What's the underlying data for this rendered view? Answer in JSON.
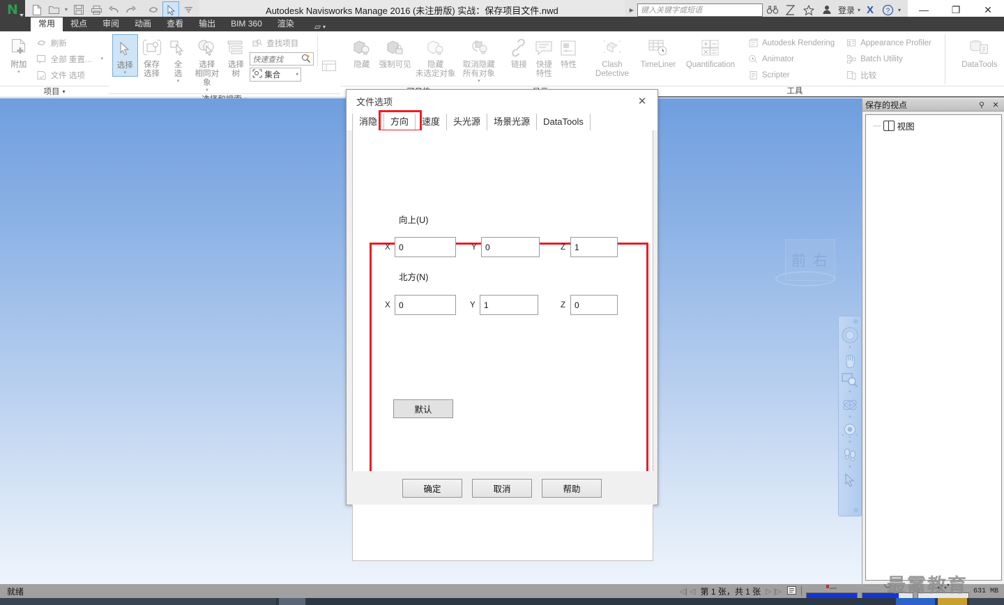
{
  "titlebar": {
    "logo_label": "N",
    "app_title": "Autodesk Navisworks Manage 2016 (未注册版)   实战：保存项目文件.nwd",
    "search_placeholder": "键入关键字或短语",
    "signin_label": "登录",
    "quick_access": [
      {
        "name": "new-file",
        "glyph": "🗋"
      },
      {
        "name": "open-file",
        "glyph": "🗁"
      },
      {
        "name": "open-dropdown",
        "glyph": "▾"
      },
      {
        "name": "save-file",
        "glyph": "🖫"
      },
      {
        "name": "print",
        "glyph": "🖨"
      },
      {
        "name": "undo",
        "glyph": "↩"
      },
      {
        "name": "redo",
        "glyph": "↪"
      },
      {
        "name": "refresh",
        "glyph": "⟳"
      },
      {
        "name": "select-cursor",
        "glyph": "➢"
      },
      {
        "name": "customize",
        "glyph": "▾"
      }
    ],
    "right_icons": [
      {
        "name": "binoculars-icon",
        "glyph": "👓"
      },
      {
        "name": "communication-icon",
        "glyph": "⧖"
      },
      {
        "name": "favorites-star-icon",
        "glyph": "☆"
      },
      {
        "name": "user-icon",
        "glyph": "⛁"
      }
    ],
    "exchange_label": "X",
    "help_label": "?",
    "window_buttons": [
      {
        "name": "minimize-button",
        "glyph": "—"
      },
      {
        "name": "maximize-button",
        "glyph": "❐"
      },
      {
        "name": "close-button",
        "glyph": "✕"
      }
    ]
  },
  "ribbon": {
    "tabs": [
      {
        "label": "常用",
        "active": true
      },
      {
        "label": "视点",
        "active": false
      },
      {
        "label": "审阅",
        "active": false
      },
      {
        "label": "动画",
        "active": false
      },
      {
        "label": "查看",
        "active": false
      },
      {
        "label": "输出",
        "active": false
      },
      {
        "label": "BIM 360",
        "active": false
      },
      {
        "label": "渲染",
        "active": false
      }
    ],
    "tab_extra_glyph": "▱",
    "tab_extra_caret": "▾",
    "groups": [
      {
        "name": "project",
        "label": "项目",
        "label_caret": "▾",
        "big_button": {
          "label": "附加",
          "caret": "▾",
          "icon": "attach-file-icon"
        },
        "small_buttons": [
          {
            "label": "刷新",
            "icon": "refresh-icon"
          },
          {
            "label": "全部 重置...",
            "icon": "reset-all-icon",
            "caret": "▾"
          },
          {
            "label": "文件 选项",
            "icon": "file-options-icon"
          }
        ]
      },
      {
        "name": "select-search",
        "label": "选择和搜索",
        "label_caret": "▾",
        "buttons": [
          {
            "label": "选择",
            "caret": "▾",
            "icon": "select-arrow-icon",
            "active": true
          },
          {
            "label": "保存\n选择",
            "icon": "save-selection-icon"
          },
          {
            "label": "全\n选",
            "caret": "▾",
            "icon": "select-all-icon"
          },
          {
            "label": "选择\n相同对象",
            "caret": "▾",
            "icon": "select-same-icon"
          },
          {
            "label": "选择\n树",
            "icon": "selection-tree-icon"
          }
        ],
        "find_items_label": "查找项目",
        "quick_find_placeholder": "快速查找",
        "sets_label": "集合",
        "sets_caret": "▾"
      },
      {
        "name": "visibility",
        "label": "可见性",
        "label_caret": "▾",
        "buttons": [
          {
            "label": "隐藏",
            "icon": "hide-icon"
          },
          {
            "label": "强制可见",
            "icon": "require-visible-icon"
          },
          {
            "label": "隐藏\n未选定对象",
            "icon": "hide-unselected-icon"
          },
          {
            "label": "取消隐藏\n所有对象",
            "caret": "▾",
            "icon": "unhide-all-icon"
          }
        ]
      },
      {
        "name": "display",
        "label": "显示",
        "label_caret": "▾",
        "buttons": [
          {
            "label": "链接",
            "icon": "links-icon"
          },
          {
            "label": "快捷\n特性",
            "icon": "quick-properties-icon"
          },
          {
            "label": "特性",
            "icon": "properties-icon"
          }
        ]
      },
      {
        "name": "tools",
        "label": "工具",
        "buttons": [
          {
            "label": "Clash\nDetective",
            "icon": "clash-detective-icon"
          },
          {
            "label": "TimeLiner",
            "icon": "timeliner-icon"
          },
          {
            "label": "Quantification",
            "icon": "quantification-icon"
          }
        ],
        "small_buttons": [
          {
            "label": "Autodesk Rendering",
            "icon": "autodesk-rendering-icon"
          },
          {
            "label": "Animator",
            "icon": "animator-icon"
          },
          {
            "label": "Scripter",
            "icon": "scripter-icon"
          },
          {
            "label": "Appearance Profiler",
            "icon": "appearance-profiler-icon"
          },
          {
            "label": "Batch Utility",
            "icon": "batch-utility-icon"
          },
          {
            "label": "比较",
            "icon": "compare-icon"
          }
        ],
        "datatools": {
          "label": "DataTools",
          "icon": "datatools-icon"
        }
      }
    ]
  },
  "viewport": {
    "viewcube_label": "前 右",
    "nav_tools": [
      {
        "name": "steering-wheel-icon",
        "glyph": "◎"
      },
      {
        "name": "pan-hand-icon",
        "glyph": "✋"
      },
      {
        "name": "zoom-window-icon",
        "glyph": "🔍"
      },
      {
        "name": "orbit-icon",
        "glyph": "✥"
      },
      {
        "name": "look-around-icon",
        "glyph": "◉"
      },
      {
        "name": "walk-icon",
        "glyph": "⚲"
      },
      {
        "name": "select-arrow-icon",
        "glyph": "➢"
      }
    ],
    "nav_close_glyph": "⊗",
    "nav_min_glyph": "⊜"
  },
  "dock": {
    "title": "保存的视点",
    "pin_icon_glyph": "⚲",
    "close_icon_glyph": "✕",
    "tree": [
      {
        "label": "视图",
        "icon": "view-cube-icon"
      }
    ]
  },
  "statusbar": {
    "ready_text": "就绪",
    "page_text": "第 1 张，共 1 张",
    "nav_first_glyph": "◁|",
    "nav_prev_glyph": "◁",
    "nav_next_glyph": "▷",
    "nav_last_glyph": "|▷",
    "list_glyph": "☰",
    "memory_text": "631 MB",
    "meters": [
      {
        "name": "disk-meter",
        "fill": 100
      },
      {
        "name": "web-meter",
        "fill": 72
      },
      {
        "name": "render-meter",
        "fill": 0
      }
    ],
    "watermark": "最霱教育"
  },
  "dialog": {
    "title": "文件选项",
    "close_glyph": "✕",
    "tabs": [
      {
        "label": "消隐",
        "active": false
      },
      {
        "label": "方向",
        "active": true
      },
      {
        "label": "速度",
        "active": false
      },
      {
        "label": "头光源",
        "active": false
      },
      {
        "label": "场景光源",
        "active": false
      },
      {
        "label": "DataTools",
        "active": false
      }
    ],
    "sections": [
      {
        "name": "up",
        "label": "向上(U)",
        "fields": [
          {
            "axis": "X",
            "value": "0"
          },
          {
            "axis": "Y",
            "value": "0"
          },
          {
            "axis": "Z",
            "value": "1"
          }
        ]
      },
      {
        "name": "north",
        "label": "北方(N)",
        "fields": [
          {
            "axis": "X",
            "value": "0"
          },
          {
            "axis": "Y",
            "value": "1"
          },
          {
            "axis": "Z",
            "value": "0"
          }
        ]
      }
    ],
    "default_button": "默认",
    "footer_buttons": [
      {
        "name": "ok-button",
        "label": "确定"
      },
      {
        "name": "cancel-button",
        "label": "取消"
      },
      {
        "name": "help-button",
        "label": "帮助"
      }
    ]
  },
  "colors": {
    "accent_red": "#ee1c25",
    "ribbon_dark": "#3f3f3f",
    "selection_blue": "#cfe4f7",
    "meter_blue": "#1633d8"
  }
}
